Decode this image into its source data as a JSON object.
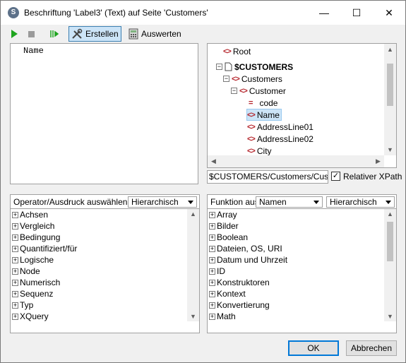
{
  "window": {
    "title": "Beschriftung 'Label3' (Text) auf Seite 'Customers'",
    "minimize": "—",
    "maximize": "☐",
    "close": "✕"
  },
  "toolbar": {
    "build_label": "Erstellen",
    "evaluate_label": "Auswerten"
  },
  "editor": {
    "text": "Name"
  },
  "schema_tree": {
    "items": [
      {
        "label": "Root",
        "kind": "element"
      },
      {
        "label": "$CUSTOMERS",
        "kind": "document"
      },
      {
        "label": "Customers",
        "kind": "element"
      },
      {
        "label": "Customer",
        "kind": "element"
      },
      {
        "label": "code",
        "kind": "attribute"
      },
      {
        "label": "Name",
        "kind": "element",
        "selected": true
      },
      {
        "label": "AddressLine01",
        "kind": "element"
      },
      {
        "label": "AddressLine02",
        "kind": "element"
      },
      {
        "label": "City",
        "kind": "element"
      }
    ]
  },
  "xpath_bar": {
    "path_value": "$CUSTOMERS/Customers/Custom",
    "relative_xpath_label": "Relativer XPath",
    "relative_xpath_checked": true
  },
  "operators_panel": {
    "header_label": "Operator/Ausdruck auswählen",
    "view_select": "Hierarchisch",
    "items": [
      "Achsen",
      "Vergleich",
      "Bedingung",
      "Quantifiziert/für",
      "Logische",
      "Node",
      "Numerisch",
      "Sequenz",
      "Typ",
      "XQuery"
    ]
  },
  "functions_panel": {
    "header_label": "Funktion aus",
    "names_select": "Namen",
    "view_select": "Hierarchisch",
    "items": [
      "Array",
      "Bilder",
      "Boolean",
      "Dateien, OS, URI",
      "Datum und Uhrzeit",
      "ID",
      "Konstruktoren",
      "Kontext",
      "Konvertierung",
      "Math"
    ]
  },
  "footer": {
    "ok_label": "OK",
    "cancel_label": "Abbrechen"
  },
  "colors": {
    "accent": "#0078d7",
    "tag": "#b5262d",
    "selection": "#cce4f7"
  }
}
